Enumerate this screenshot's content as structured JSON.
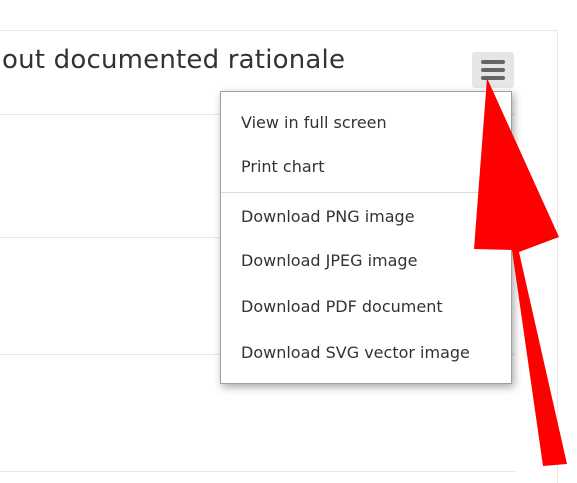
{
  "chart": {
    "title": "out documented rationale"
  },
  "export_menu": {
    "button_icon": "hamburger-icon",
    "groups": [
      [
        "View in full screen",
        "Print chart"
      ],
      [
        "Download PNG image",
        "Download JPEG image",
        "Download PDF document",
        "Download SVG vector image"
      ]
    ]
  },
  "colors": {
    "title_text": "#333333",
    "menu_text": "#333333",
    "button_background": "#e6e6e6",
    "icon_color": "#666666",
    "gridline": "#e6e6e6",
    "annotation_arrow": "#ff0000"
  }
}
